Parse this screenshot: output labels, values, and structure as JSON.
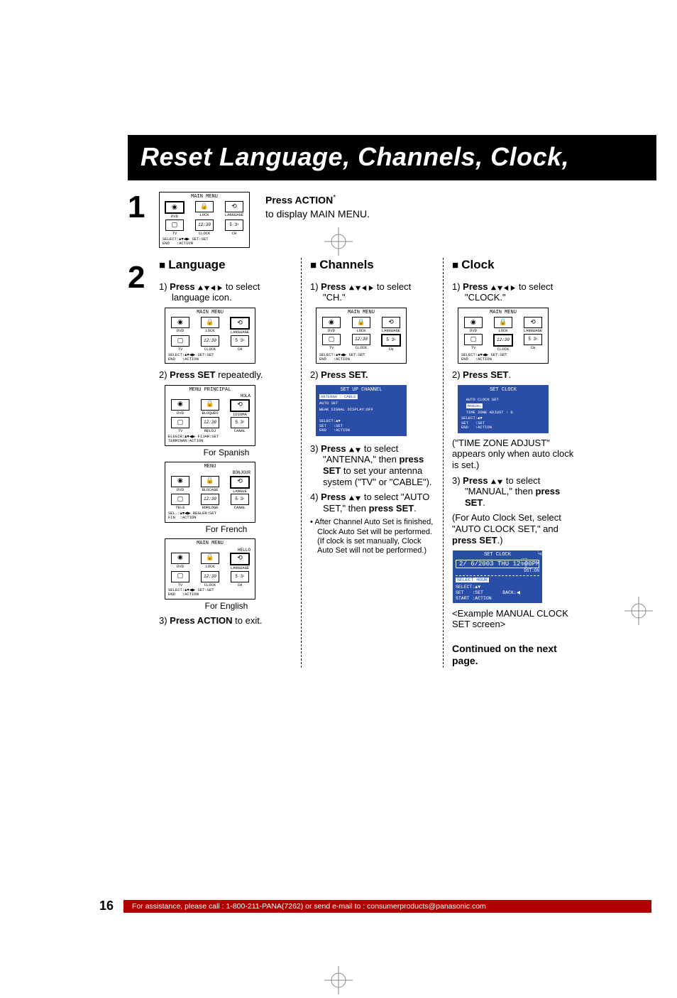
{
  "page_number": "16",
  "title_bar": "Reset Language, Channels, Clock,",
  "footer_text": "For assistance, please call : 1-800-211-PANA(7262) or send e-mail to : consumerproducts@panasonic.com",
  "step1": {
    "num": "1",
    "line1_b": "Press ACTION",
    "line1_sup": "*",
    "line2": "to display MAIN MENU."
  },
  "step2": {
    "num": "2"
  },
  "main_menu": {
    "title_en": "MAIN MENU",
    "title_es": "MENU PRINCIPAL",
    "title_fr": "MENU",
    "greet_es": "HOLA",
    "greet_fr": "BONJOUR",
    "greet_en": "HELLO",
    "row1": {
      "en": [
        "DVD",
        "LOCK",
        "LANGUAGE"
      ],
      "es": [
        "DVD",
        "BLOQUEO",
        "IDIOMA"
      ],
      "fr": [
        "DVD",
        "BLOCAGE",
        "LANGUE"
      ]
    },
    "row2": {
      "en": [
        "TV",
        "CLOCK",
        "CH"
      ],
      "es": [
        "TV",
        "RELOJ",
        "CANAL"
      ],
      "fr": [
        "TELE",
        "HORLOGE",
        "CANAL"
      ]
    },
    "foot_en": "SELECT:▲▼◀▶ SET:SET\nEND   :ACTION",
    "foot_es": "ELEGIR:▲▼◀▶ FIJAR:SET\nTERMINAR:ACTION",
    "foot_fr": "SEL.:▲▼◀▶ REGLER:SET\nFIN  :ACTION"
  },
  "lang": {
    "head": "Language",
    "s1a": "1) ",
    "s1b": "Press ",
    "s1c": " to select language icon.",
    "s2a": "2) ",
    "s2b": "Press SET",
    "s2c": " repeatedly.",
    "cap_es": "For Spanish",
    "cap_fr": "For French",
    "cap_en": "For English",
    "s3": "3) ",
    "s3b": "Press ACTION",
    "s3c": " to exit."
  },
  "channels": {
    "head": "Channels",
    "s1a": "1) ",
    "s1b": "Press ",
    "s1c": " to select \"CH.\"",
    "s2": "2) ",
    "s2b": "Press SET.",
    "setup_title": "SET UP CHANNEL",
    "ant": "ANTENNA : CABLE",
    "auto": "AUTO SET",
    "weak": "WEAK SIGNAL DISPLAY:OFF",
    "foot": "SELECT:▲▼\nSET   :SET\nEND   :ACTION",
    "s3a": "3) ",
    "s3b": "Press ",
    "s3c": " to select \"ANTENNA,\" then ",
    "s3d": "press SET",
    "s3e": " to set your antenna system (\"TV\" or \"CABLE\").",
    "s4a": "4) ",
    "s4b": "Press ",
    "s4c": " to select \"AUTO SET,\" then ",
    "s4d": "press SET",
    "s4e": ".",
    "bullet": "After Channel Auto Set is finished, Clock Auto Set will be performed. (If clock is set manually, Clock Auto Set will not be performed.)"
  },
  "clock": {
    "head": "Clock",
    "s1a": "1) ",
    "s1b": "Press ",
    "s1c": " to select \"CLOCK.\"",
    "s2": "2) ",
    "s2b": "Press SET",
    "s2c": ".",
    "set_title": "SET CLOCK",
    "auto": "AUTO CLOCK SET",
    "manual": "MANUAL",
    "tz": "TIME ZONE ADJUST : 0",
    "foot": "SELECT:▲▼\nSET   :SET\nEND   :ACTION",
    "paren1": "(\"TIME ZONE ADJUST\" appears only when auto clock is set.)",
    "s3a": "3) ",
    "s3b": "Press ",
    "s3c": " to select \"MANUAL,\" then ",
    "s3d": "press SET",
    "s3e": ".",
    "paren2": "(For Auto Clock Set, select \"AUTO CLOCK SET,\" and ",
    "paren2b": "press SET",
    "paren2c": ".)",
    "date": "2/ 6/2003 THU 12:00PM",
    "dst": "DST:ON",
    "selhour": "SELECT HOUR",
    "foot2": "SELECT:▲▼\nSET   :SET       BACK:◀\nSTART :ACTION",
    "example": "<Example MANUAL CLOCK SET screen>",
    "cont": "Continued on the next page."
  }
}
